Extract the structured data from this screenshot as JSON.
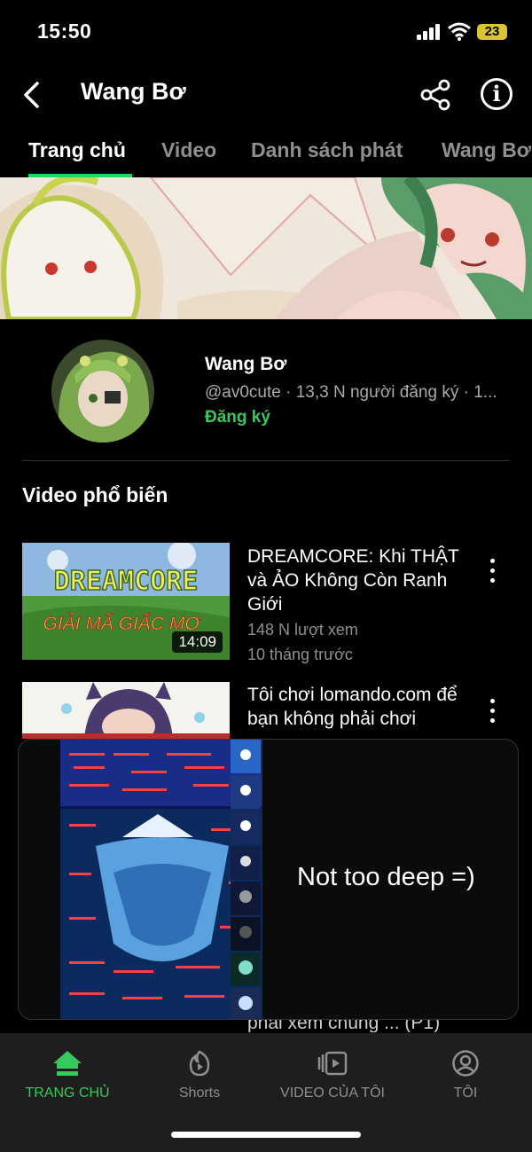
{
  "status": {
    "time": "15:50",
    "battery": "23"
  },
  "header": {
    "title": "Wang Bơ"
  },
  "tabs": [
    {
      "label": "Trang chủ"
    },
    {
      "label": "Video"
    },
    {
      "label": "Danh sách phát"
    },
    {
      "label": "Wang Bơ"
    }
  ],
  "channel": {
    "name": "Wang Bơ",
    "meta": "@av0cute · 13,3 N người đăng ký · 1...",
    "subscribe": "Đăng ký"
  },
  "section_title": "Video phổ biến",
  "videos": [
    {
      "title": "DREAMCORE: Khi THẬT và ẢO Không Còn Ranh Giới",
      "views": "148 N lượt xem",
      "age": "10 tháng trước",
      "duration": "14:09",
      "thumb_text_1": "DREAMCORE",
      "thumb_text_2": "GIẢI MÃ GIẤC MƠ"
    },
    {
      "title": "Tôi chơi lomando.com để bạn không phải chơi",
      "title_tail": "phải xem chúng ... (P1)"
    }
  ],
  "popup": {
    "text": "Not too deep =)"
  },
  "bottom_nav": [
    {
      "label": "TRANG CHỦ",
      "icon": "home-icon"
    },
    {
      "label": "Shorts",
      "icon": "shorts-icon"
    },
    {
      "label": "VIDEO CỦA TÔI",
      "icon": "my-videos-icon"
    },
    {
      "label": "TÔI",
      "icon": "profile-icon"
    }
  ],
  "colors": {
    "accent": "#1ed760",
    "subscribe": "#36c95b",
    "battery": "#d8c531"
  }
}
